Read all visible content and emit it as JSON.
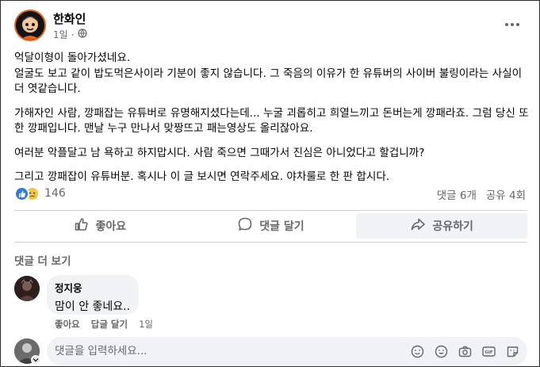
{
  "post": {
    "author": "한화인",
    "time": "1일",
    "privacy_icon": "globe-icon",
    "more_icon": "more-dots-icon",
    "paragraphs": [
      "억달이형이 돌아가셨네요.",
      "얼굴도 보고 같이 밥도먹은사이라 기분이 좋지 않습니다. 그 죽음의 이유가 한 유튜버의 사이버 불링이라는 사실이 더 엿같습니다.",
      "가해자인 사람, 깡패잡는 유튜버로 유명해지셨다는데... 누굴 괴롭히고 희열느끼고 돈버는게 깡패라죠. 그럼 당신 또한 깡패입니다. 맨날 누구 만나서 맞짱뜨고 패는영상도 올리잖아요.",
      "여러분 악플달고 남 욕하고 하지맙시다. 사람 죽으면 그때가서 진심은 아니었다고 할겁니까?",
      "그리고 깡패잡이 유튜버분. 혹시나 이 글 보시면 연락주세요. 야차룰로 한 판 합시다."
    ],
    "reactions": {
      "types": [
        "like",
        "sad"
      ],
      "count": "146",
      "comments": "댓글 6개",
      "shares": "공유 4회"
    }
  },
  "actions": {
    "like": {
      "label": "좋아요",
      "icon": "thumbs-up-icon"
    },
    "comment": {
      "label": "댓글 달기",
      "icon": "comment-bubble-icon"
    },
    "share": {
      "label": "공유하기",
      "icon": "share-arrow-icon"
    }
  },
  "comments_section": {
    "more_comments": "댓글 더 보기",
    "items": [
      {
        "name": "정지웅",
        "text": "맘이 안 좋네요..",
        "like": "좋아요",
        "reply": "답글 달기",
        "time": "1일"
      }
    ]
  },
  "composer": {
    "placeholder": "댓글을 입력하세요...",
    "tools": [
      "sticker-icon",
      "emoji-icon",
      "camera-icon",
      "gif-icon",
      "avatar-sticker-icon"
    ]
  },
  "colors": {
    "primary_text": "#050505",
    "secondary_text": "#65676b",
    "like_blue": "#2a78f5",
    "sad_yellow": "#f7c342",
    "bubble_bg": "#f0f2f5"
  }
}
